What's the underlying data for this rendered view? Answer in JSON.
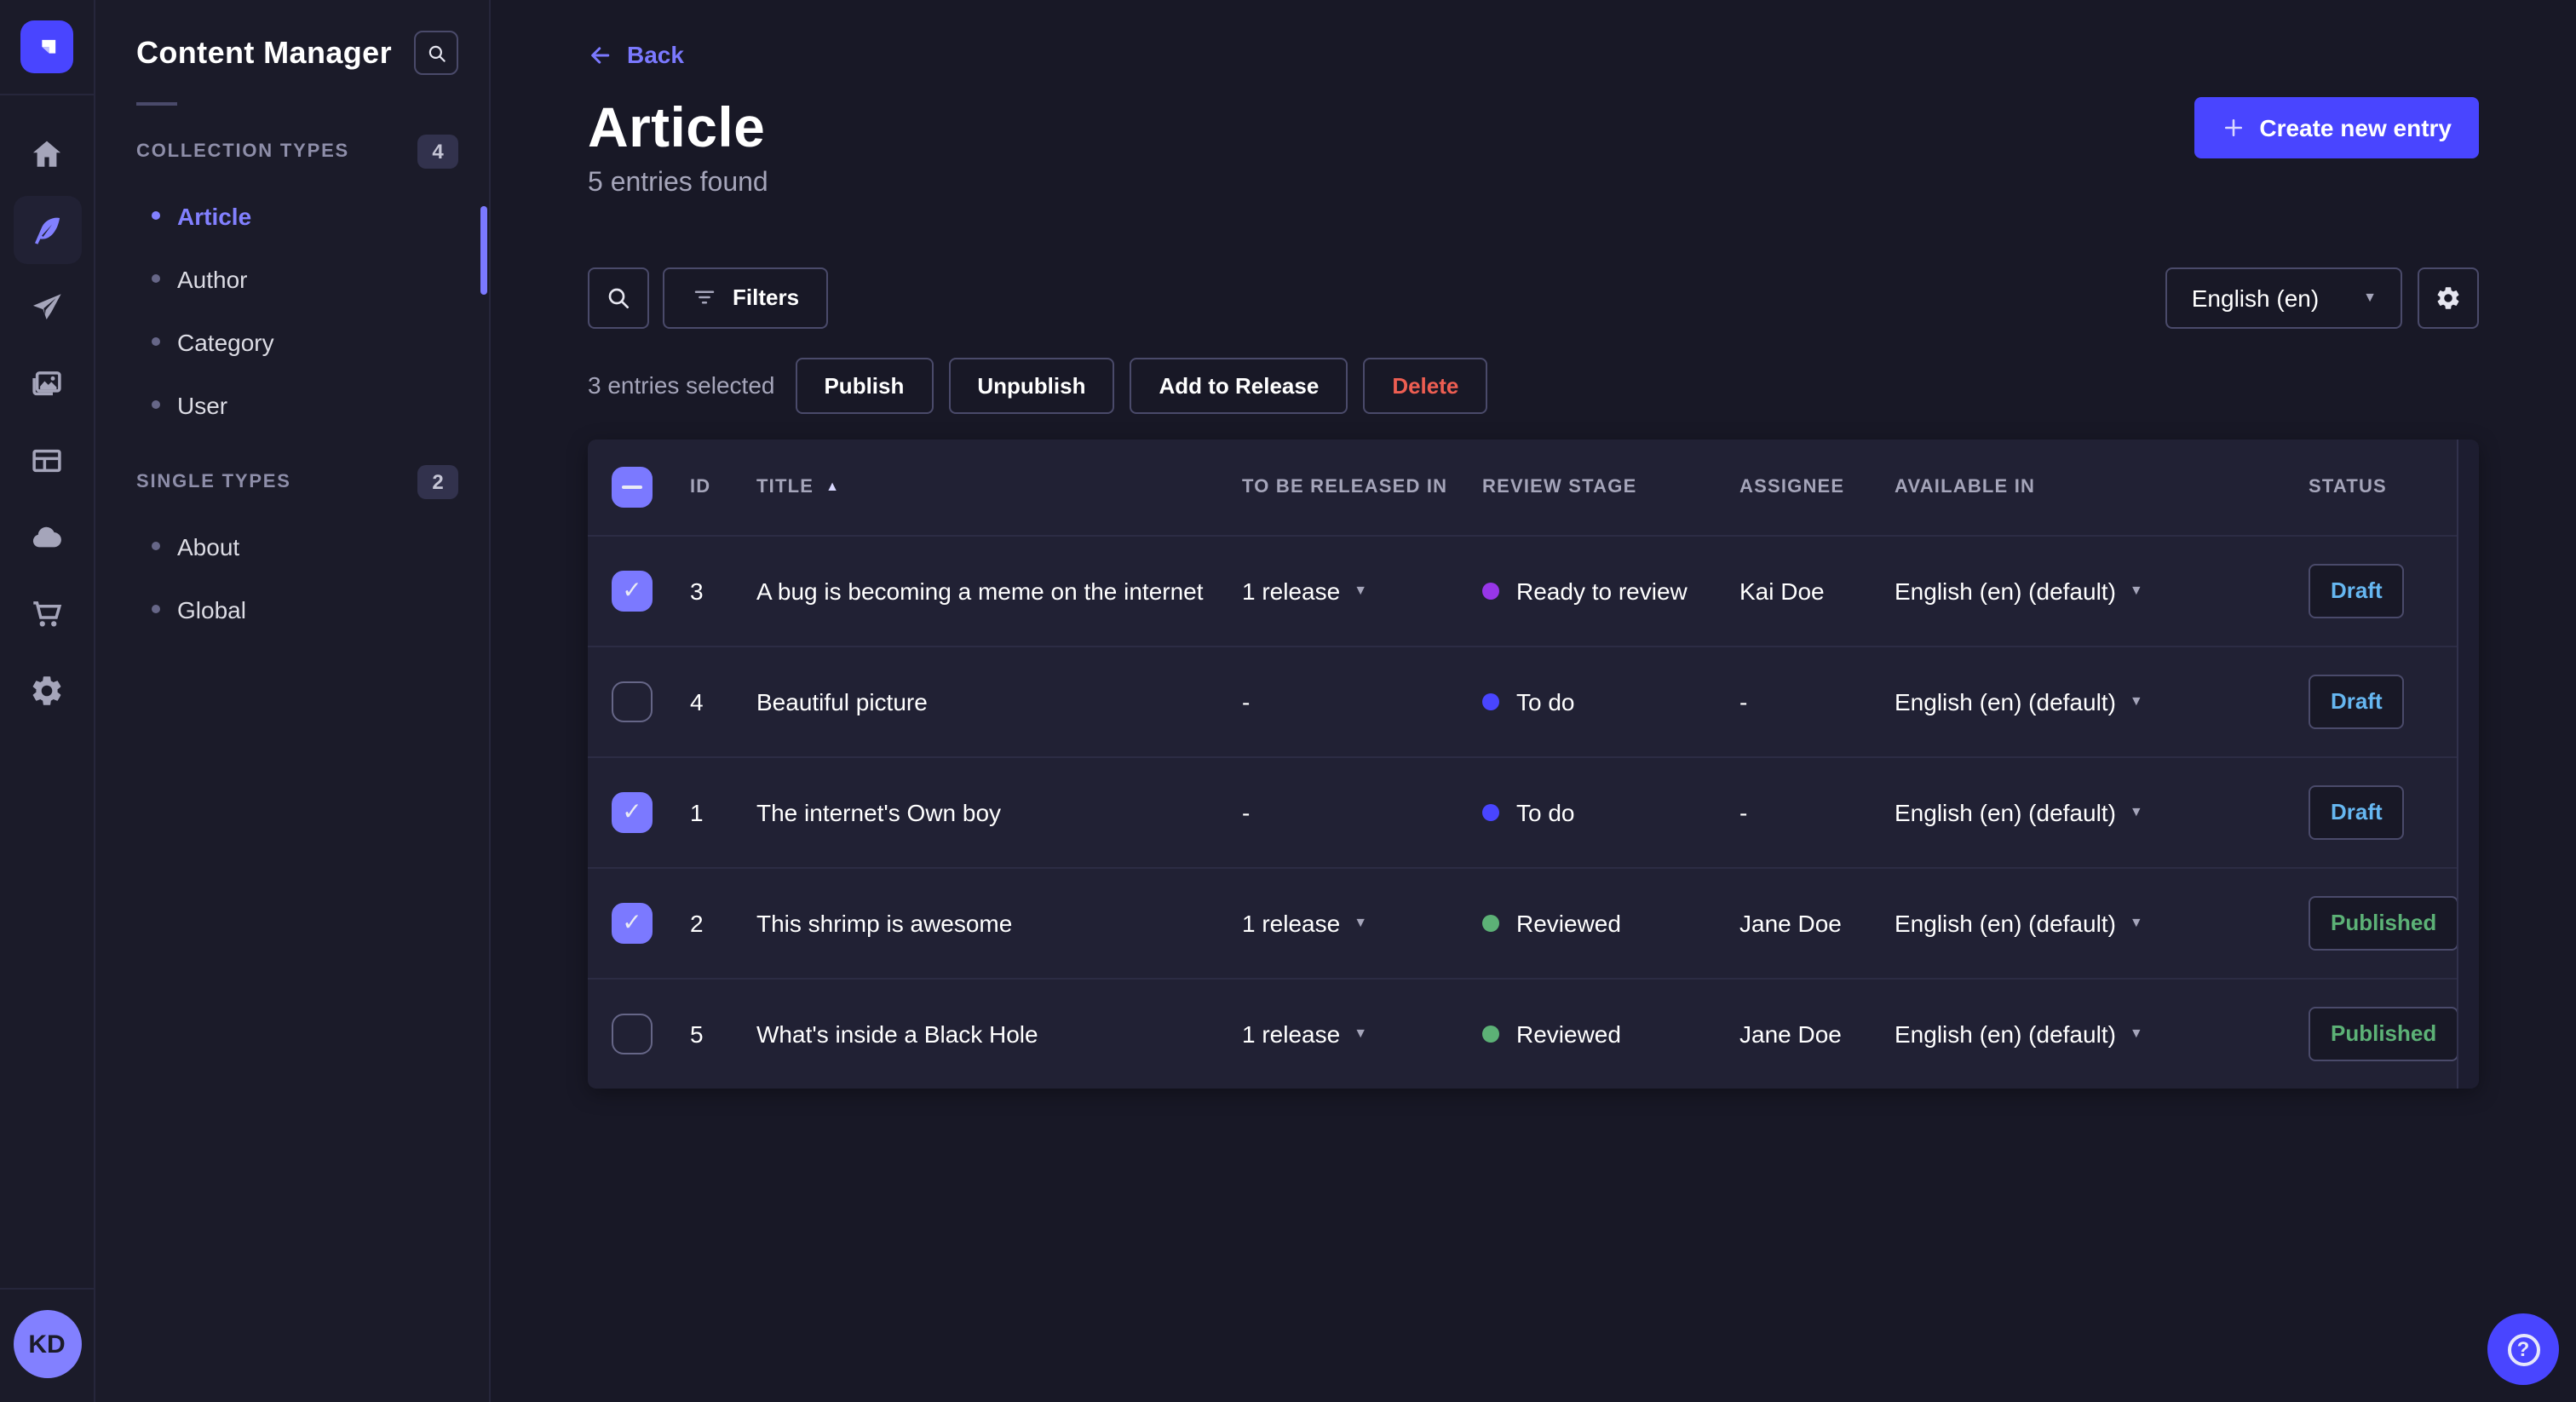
{
  "nav_rail": {
    "items": [
      {
        "icon": "home-icon",
        "active": false
      },
      {
        "icon": "content-manager-icon",
        "active": true
      },
      {
        "icon": "releases-icon",
        "active": false
      },
      {
        "icon": "media-library-icon",
        "active": false
      },
      {
        "icon": "content-type-builder-icon",
        "active": false
      },
      {
        "icon": "deploy-icon",
        "active": false
      },
      {
        "icon": "marketplace-icon",
        "active": false
      },
      {
        "icon": "settings-icon",
        "active": false
      }
    ],
    "avatar_initials": "KD"
  },
  "sidebar": {
    "title": "Content Manager",
    "sections": [
      {
        "label": "COLLECTION TYPES",
        "count": "4",
        "items": [
          {
            "label": "Article",
            "active": true
          },
          {
            "label": "Author",
            "active": false
          },
          {
            "label": "Category",
            "active": false
          },
          {
            "label": "User",
            "active": false
          }
        ]
      },
      {
        "label": "SINGLE TYPES",
        "count": "2",
        "items": [
          {
            "label": "About",
            "active": false
          },
          {
            "label": "Global",
            "active": false
          }
        ]
      }
    ]
  },
  "header": {
    "back_label": "Back",
    "title": "Article",
    "subtitle": "5 entries found",
    "create_button_label": "Create new entry"
  },
  "toolbar": {
    "filters_label": "Filters",
    "locale_value": "English (en)"
  },
  "selection": {
    "text": "3 entries selected",
    "actions": [
      {
        "label": "Publish",
        "variant": "default"
      },
      {
        "label": "Unpublish",
        "variant": "default"
      },
      {
        "label": "Add to Release",
        "variant": "default"
      },
      {
        "label": "Delete",
        "variant": "danger"
      }
    ]
  },
  "table": {
    "columns": [
      "ID",
      "TITLE",
      "TO BE RELEASED IN",
      "REVIEW STAGE",
      "ASSIGNEE",
      "AVAILABLE IN",
      "STATUS"
    ],
    "sorted_column": "TITLE",
    "rows": [
      {
        "checked": true,
        "id": "3",
        "title": "A bug is becoming a meme on the internet",
        "release": "1 release",
        "review_stage": "Ready to review",
        "review_color": "#9736e8",
        "assignee": "Kai Doe",
        "available": "English (en) (default)",
        "status": "Draft",
        "status_color": "#66b7f1"
      },
      {
        "checked": false,
        "id": "4",
        "title": "Beautiful picture",
        "release": "-",
        "review_stage": "To do",
        "review_color": "#4945ff",
        "assignee": "-",
        "available": "English (en) (default)",
        "status": "Draft",
        "status_color": "#66b7f1"
      },
      {
        "checked": true,
        "id": "1",
        "title": "The internet's Own boy",
        "release": "-",
        "review_stage": "To do",
        "review_color": "#4945ff",
        "assignee": "-",
        "available": "English (en) (default)",
        "status": "Draft",
        "status_color": "#66b7f1"
      },
      {
        "checked": true,
        "id": "2",
        "title": "This shrimp is awesome",
        "release": "1 release",
        "review_stage": "Reviewed",
        "review_color": "#5cb176",
        "assignee": "Jane Doe",
        "available": "English (en) (default)",
        "status": "Published",
        "status_color": "#5cb176"
      },
      {
        "checked": false,
        "id": "5",
        "title": "What's inside a Black Hole",
        "release": "1 release",
        "review_stage": "Reviewed",
        "review_color": "#5cb176",
        "assignee": "Jane Doe",
        "available": "English (en) (default)",
        "status": "Published",
        "status_color": "#5cb176"
      }
    ]
  },
  "colors": {
    "primary": "#4945ff",
    "accent": "#7b79ff",
    "draft": "#66b7f1",
    "published": "#5cb176",
    "danger": "#ee5e52"
  }
}
